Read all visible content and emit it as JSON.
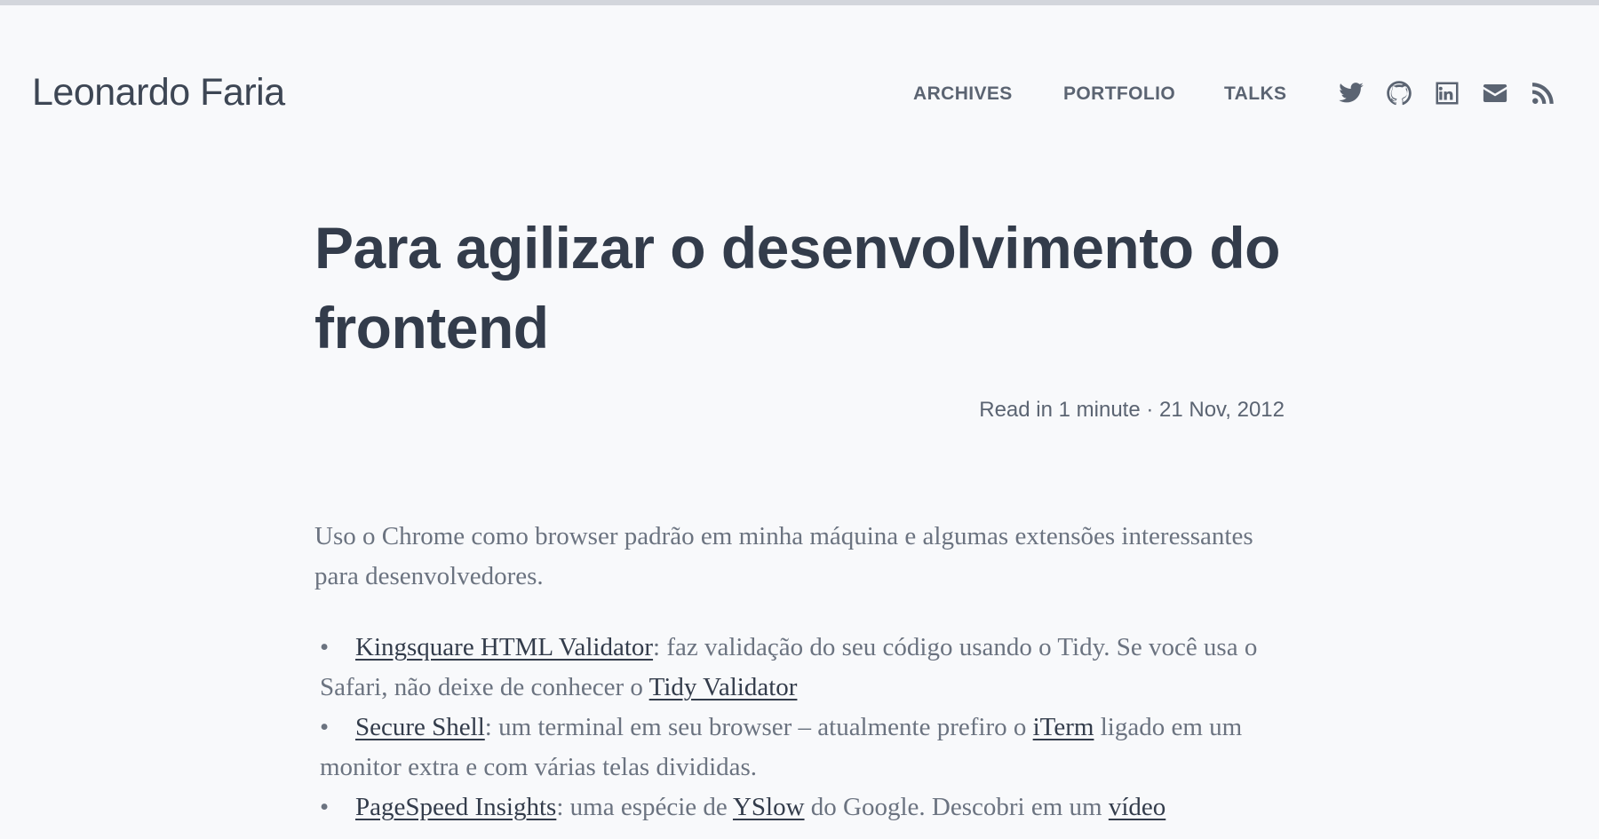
{
  "header": {
    "site_title": "Leonardo Faria",
    "nav": [
      "ARCHIVES",
      "PORTFOLIO",
      "TALKS"
    ],
    "social_icons": [
      "twitter-icon",
      "github-icon",
      "linkedin-icon",
      "email-icon",
      "rss-icon"
    ]
  },
  "post": {
    "title": "Para agilizar o desenvolvimento do frontend",
    "meta": "Read in 1 minute · 21 Nov, 2012",
    "intro": "Uso o Chrome como browser padrão em minha máquina e algumas extensões interessantes para desenvolvedores.",
    "items": [
      {
        "link": "Kingsquare HTML Validator",
        "text": ": faz validação do seu código usando o Tidy. Se você usa o Safari, não deixe de conhecer o ",
        "link2": "Tidy Validator",
        "text2": ""
      },
      {
        "link": "Secure Shell",
        "text": ": um terminal em seu browser – atualmente prefiro o ",
        "link2": "iTerm",
        "text2": " ligado em um monitor extra e com várias telas divididas."
      },
      {
        "link": "PageSpeed Insights",
        "text": ": uma espécie de ",
        "link2": "YSlow",
        "text2": " do Google. Descobri em um ",
        "link3": "vídeo"
      }
    ]
  },
  "colors": {
    "background": "#f8f9fb",
    "heading": "#333c4b",
    "text": "#6b7380",
    "nav": "#5b6472"
  }
}
